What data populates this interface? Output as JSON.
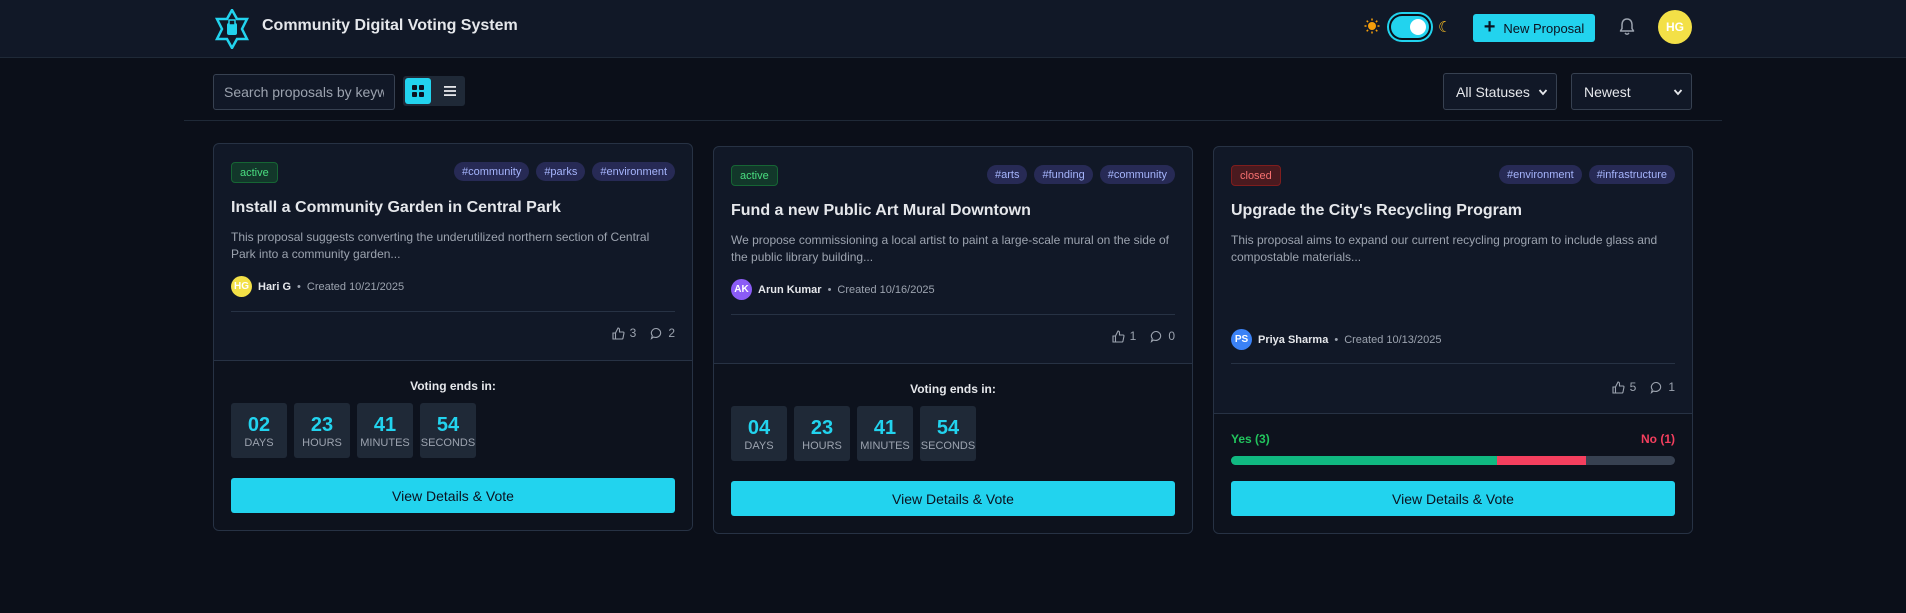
{
  "app": {
    "title": "Community Digital Voting System",
    "new_proposal_label": "New Proposal",
    "user_initials": "HG"
  },
  "colors": {
    "accent": "#22d3ee",
    "active": "#4ade80",
    "closed": "#f87171",
    "yes": "#10b981",
    "no": "#f43f5e"
  },
  "toolbar": {
    "search_placeholder": "Search proposals by keyword",
    "status_filter": "All Statuses",
    "sort": "Newest"
  },
  "proposals": [
    {
      "status": "active",
      "tags": [
        "#community",
        "#parks",
        "#environment"
      ],
      "title": "Install a Community Garden in Central Park",
      "description": "This proposal suggests converting the underutilized northern section of Central Park into a community garden...",
      "author_initials": "HG",
      "author_color": "#f3e047",
      "author": "Hari G",
      "created": "Created 10/21/2025",
      "votes": "3",
      "comments": "2",
      "ends_label": "Voting ends in:",
      "timer": [
        {
          "num": "02",
          "label": "DAYS"
        },
        {
          "num": "23",
          "label": "HOURS"
        },
        {
          "num": "41",
          "label": "MINUTES"
        },
        {
          "num": "54",
          "label": "SECONDS"
        }
      ],
      "button": "View Details & Vote"
    },
    {
      "status": "active",
      "tags": [
        "#arts",
        "#funding",
        "#community"
      ],
      "title": "Fund a new Public Art Mural Downtown",
      "description": "We propose commissioning a local artist to paint a large-scale mural on the side of the public library building...",
      "author_initials": "AK",
      "author_color": "#8b5cf6",
      "author": "Arun Kumar",
      "created": "Created 10/16/2025",
      "votes": "1",
      "comments": "0",
      "ends_label": "Voting ends in:",
      "timer": [
        {
          "num": "04",
          "label": "DAYS"
        },
        {
          "num": "23",
          "label": "HOURS"
        },
        {
          "num": "41",
          "label": "MINUTES"
        },
        {
          "num": "54",
          "label": "SECONDS"
        }
      ],
      "button": "View Details & Vote"
    },
    {
      "status": "closed",
      "tags": [
        "#environment",
        "#infrastructure"
      ],
      "title": "Upgrade the City's Recycling Program",
      "description": "This proposal aims to expand our current recycling program to include glass and compostable materials...",
      "author_initials": "PS",
      "author_color": "#3b82f6",
      "author": "Priya Sharma",
      "created": "Created 10/13/2025",
      "votes": "5",
      "comments": "1",
      "yes_label": "Yes (3)",
      "no_label": "No (1)",
      "yes_fraction": 0.6,
      "no_fraction": 0.2,
      "button": "View Details & Vote"
    }
  ]
}
